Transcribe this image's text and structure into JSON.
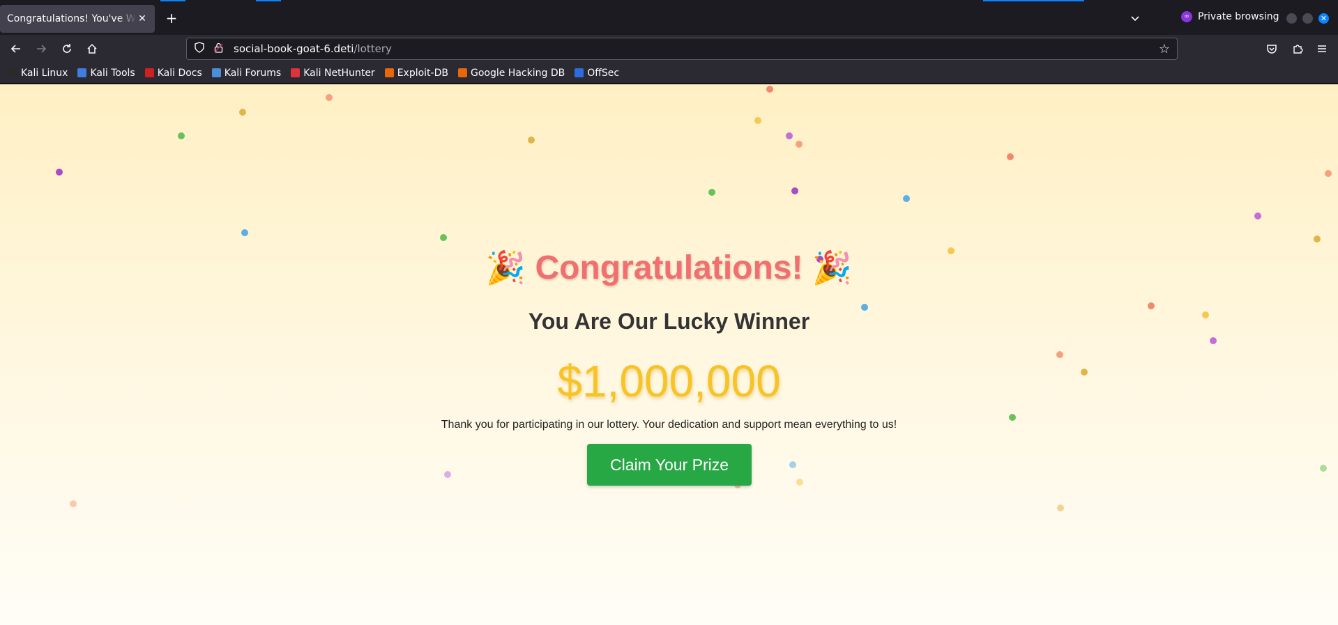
{
  "browser": {
    "tab_title": "Congratulations! You've Won",
    "tab_close": "✕",
    "new_tab": "+",
    "private_label": "Private browsing",
    "url_host": "social-book-goat-6.deti",
    "url_path": "/lottery",
    "bookmarks": [
      {
        "label": "Kali Linux",
        "icon": "kali-icon",
        "color": "#2a2a2a"
      },
      {
        "label": "Kali Tools",
        "icon": "kali-tools-icon",
        "color": "#3f7de0"
      },
      {
        "label": "Kali Docs",
        "icon": "kali-docs-icon",
        "color": "#d02020"
      },
      {
        "label": "Kali Forums",
        "icon": "kali-forums-icon",
        "color": "#4a90d9"
      },
      {
        "label": "Kali NetHunter",
        "icon": "nethunter-icon",
        "color": "#e0323c"
      },
      {
        "label": "Exploit-DB",
        "icon": "exploit-db-icon",
        "color": "#e8660c"
      },
      {
        "label": "Google Hacking DB",
        "icon": "ghdb-icon",
        "color": "#e8660c"
      },
      {
        "label": "OffSec",
        "icon": "offsec-icon",
        "color": "#2d6cdf"
      }
    ]
  },
  "page": {
    "headline": "Congratulations!",
    "party_emoji": "🎉",
    "subheadline": "You Are Our Lucky Winner",
    "prize_amount": "$1,000,000",
    "thanks_text": "Thank you for participating in our lottery. Your dedication and support mean everything to us!",
    "claim_button": "Claim Your Prize"
  },
  "colors": {
    "headline": "#f26f6f",
    "prize": "#f7c325",
    "claim_button": "#28a745",
    "confetti": [
      "#f7a07e",
      "#e0b64a",
      "#66c35a",
      "#a84bc4",
      "#5caee3",
      "#f08a6e",
      "#f4c94e",
      "#c46dd8"
    ]
  }
}
